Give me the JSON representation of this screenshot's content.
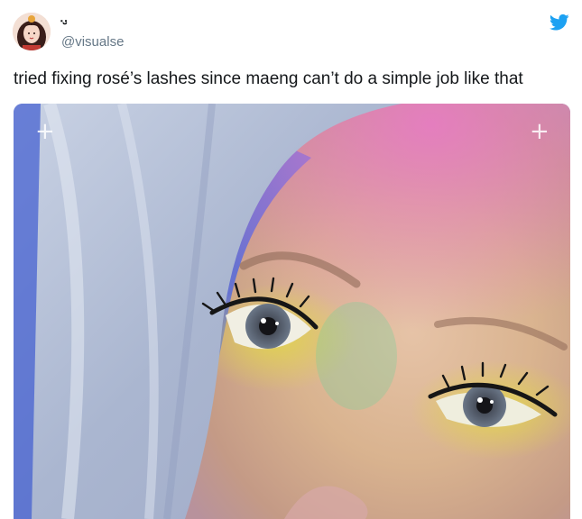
{
  "tweet": {
    "display_name": "‥̮",
    "handle": "@visualse",
    "text": "tried fixing rosé’s lashes since maeng can’t do a simple job like that"
  },
  "icons": {
    "brand": "twitter-bird-icon",
    "corner_marks": "plus-icon"
  },
  "colors": {
    "twitter_blue": "#1da1f2",
    "text_primary": "#14171a",
    "text_secondary": "#657786"
  }
}
